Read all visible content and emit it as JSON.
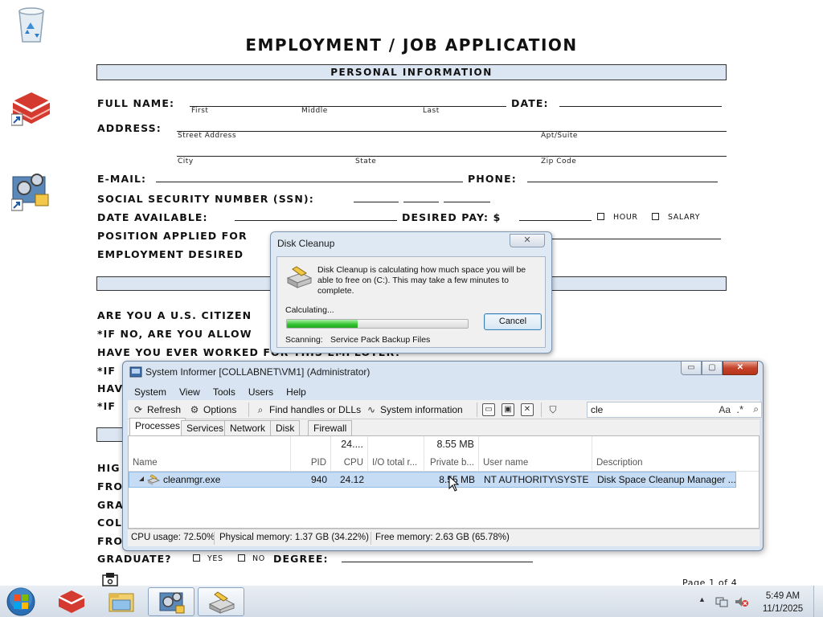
{
  "form": {
    "title": "EMPLOYMENT / JOB APPLICATION",
    "section_personal": "PERSONAL INFORMATION",
    "full_name_label": "FULL NAME:",
    "name_first": "First",
    "name_middle": "Middle",
    "name_last": "Last",
    "date_label": "DATE:",
    "address_label": "ADDRESS:",
    "street_address": "Street Address",
    "apt_suite": "Apt/Suite",
    "city": "City",
    "state": "State",
    "zip_code": "Zip Code",
    "email_label": "E-MAIL:",
    "phone_label": "PHONE:",
    "ssn_label": "SOCIAL SECURITY NUMBER (SSN):",
    "date_available_label": "DATE AVAILABLE:",
    "desired_pay_label": "DESIRED PAY: $",
    "hour": "HOUR",
    "salary": "SALARY",
    "position_label": "POSITION APPLIED FOR",
    "employment_desired_label": "EMPLOYMENT DESIRED",
    "citizen_label": "ARE YOU A U.S. CITIZEN",
    "if_no_label": "*IF NO, ARE YOU ALLOW",
    "worked_label": "HAVE YOU EVER WORKED FOR THIS EMPLOYER?",
    "if_row_1": "*IF",
    "hav_row": "HAV",
    "if_row_2": "*IF",
    "high_row": "HIG",
    "from_row_1": "FRO",
    "gra_row": "GRA",
    "col_row": "COL",
    "from_row_2": "FRO",
    "graduate_label": "GRADUATE?",
    "yes": "YES",
    "no": "NO",
    "degree_label": "DEGREE:",
    "page_indicator": "Page 1 of 4"
  },
  "disk_cleanup": {
    "title": "Disk Cleanup",
    "close_glyph": "✕",
    "message": "Disk Cleanup is calculating how much space you will be able to free on  (C:). This may take a few minutes to complete.",
    "calculating": "Calculating...",
    "progress": 0.39,
    "cancel_label": "Cancel",
    "scanning_label": "Scanning:",
    "scanning_value": "Service Pack Backup Files"
  },
  "system_informer": {
    "title": "System Informer [COLLABNET\\VM1] (Administrator)",
    "window_buttons": {
      "minimize": "▭",
      "maximize": "▢",
      "close": "✕"
    },
    "menu": [
      "System",
      "View",
      "Tools",
      "Users",
      "Help"
    ],
    "toolbar": {
      "refresh": "Refresh",
      "options": "Options",
      "find_handles": "Find handles or DLLs",
      "system_information": "System information"
    },
    "search": {
      "value": "cle",
      "case_toggle": "Aa",
      "regex_toggle": ".*"
    },
    "tabs": [
      "Processes",
      "Services",
      "Network",
      "Disk",
      "Firewall"
    ],
    "columns": {
      "name": "Name",
      "pid": "PID",
      "cpu": "CPU",
      "io_total": "I/O total r...",
      "private_bytes": "Private b...",
      "user_name": "User name",
      "description": "Description"
    },
    "totals": {
      "cpu": "24....",
      "private_bytes": "8.55 MB"
    },
    "rows": [
      {
        "name": "cleanmgr.exe",
        "pid": "940",
        "cpu": "24.12",
        "io_total": "",
        "private_bytes": "8.55 MB",
        "user_name": "NT AUTHORITY\\SYSTEM",
        "description": "Disk Space Cleanup Manager ..."
      }
    ],
    "status": {
      "cpu_usage": "CPU usage: 72.50%",
      "physical_memory": "Physical memory: 1.37 GB (34.22%)",
      "free_memory": "Free memory: 2.63 GB (65.78%)"
    }
  },
  "taskbar": {
    "time": "5:49 AM",
    "date": "11/1/2025",
    "tray_arrow": "▲"
  }
}
